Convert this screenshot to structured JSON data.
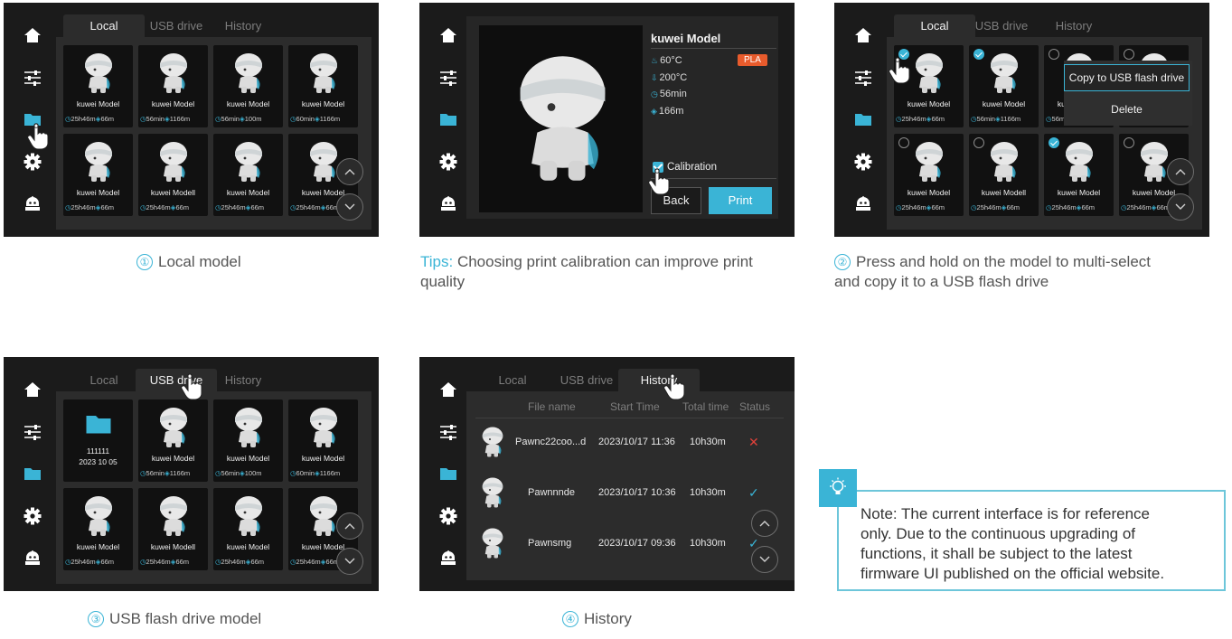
{
  "colors": {
    "accent": "#3ab4d6",
    "pla": "#e85b2c",
    "fail": "#e0413a"
  },
  "tabs": {
    "local": "Local",
    "usb": "USB drive",
    "history": "History"
  },
  "local_models": [
    {
      "name": "kuwei Model",
      "time": "25h46m",
      "len": "66m"
    },
    {
      "name": "kuwei Model",
      "time": "56min",
      "len": "1166m"
    },
    {
      "name": "kuwei Model",
      "time": "56min",
      "len": "100m"
    },
    {
      "name": "kuwei Model",
      "time": "60min",
      "len": "1166m"
    },
    {
      "name": "kuwei Model",
      "time": "25h46m",
      "len": "66m"
    },
    {
      "name": "kuwei Modell",
      "time": "25h46m",
      "len": "66m"
    },
    {
      "name": "kuwei Model",
      "time": "25h46m",
      "len": "66m"
    },
    {
      "name": "kuwei Model",
      "time": "25h46m",
      "len": "66m"
    }
  ],
  "detail": {
    "title": "kuwei Model",
    "material": "PLA",
    "bed_temp": "60°C",
    "nozzle_temp": "200°C",
    "time": "56min",
    "length": "166m",
    "calibration_label": "Calibration",
    "calibration_checked": true,
    "back": "Back",
    "print": "Print"
  },
  "multiselect": {
    "copy_label": "Copy to USB flash drive",
    "delete_label": "Delete",
    "selected": [
      true,
      true,
      false,
      false,
      false,
      false,
      true,
      false
    ]
  },
  "usb": {
    "folder_name": "111111",
    "folder_date": "2023 10 05"
  },
  "history": {
    "headers": [
      "File name",
      "Start Time",
      "Total time",
      "Status"
    ],
    "rows": [
      {
        "file": "Pawnc22coo...d",
        "start": "2023/10/17 11:36",
        "total": "10h30m",
        "status": "failed"
      },
      {
        "file": "Pawnnnde",
        "start": "2023/10/17 10:36",
        "total": "10h30m",
        "status": "done"
      },
      {
        "file": "Pawnsmg",
        "start": "2023/10/17 09:36",
        "total": "10h30m",
        "status": "done"
      }
    ]
  },
  "captions": {
    "c1_num": "①",
    "c1": "Local model",
    "tips_label": "Tips:",
    "tips_line1": " Choosing print calibration can improve print",
    "tips_line2": "quality",
    "c2_num": "②",
    "c2_line1": "Press and hold on the model to multi-select",
    "c2_line2": "and copy it to a USB flash drive",
    "c3_num": "③",
    "c3": "USB flash drive model",
    "c4_num": "④",
    "c4": "History"
  },
  "note": {
    "line1": "Note: The current interface is for reference",
    "line2": "only. Due to the continuous upgrading of",
    "line3": "functions, it shall be subject to the latest",
    "line4": "firmware UI published on the official website."
  },
  "icons": [
    "home-icon",
    "sliders-icon",
    "folder-icon",
    "gear-icon",
    "robot-icon",
    "chevron-up-icon",
    "chevron-down-icon",
    "clock-icon",
    "filament-icon",
    "lightbulb-icon",
    "hand-pointer-icon"
  ]
}
